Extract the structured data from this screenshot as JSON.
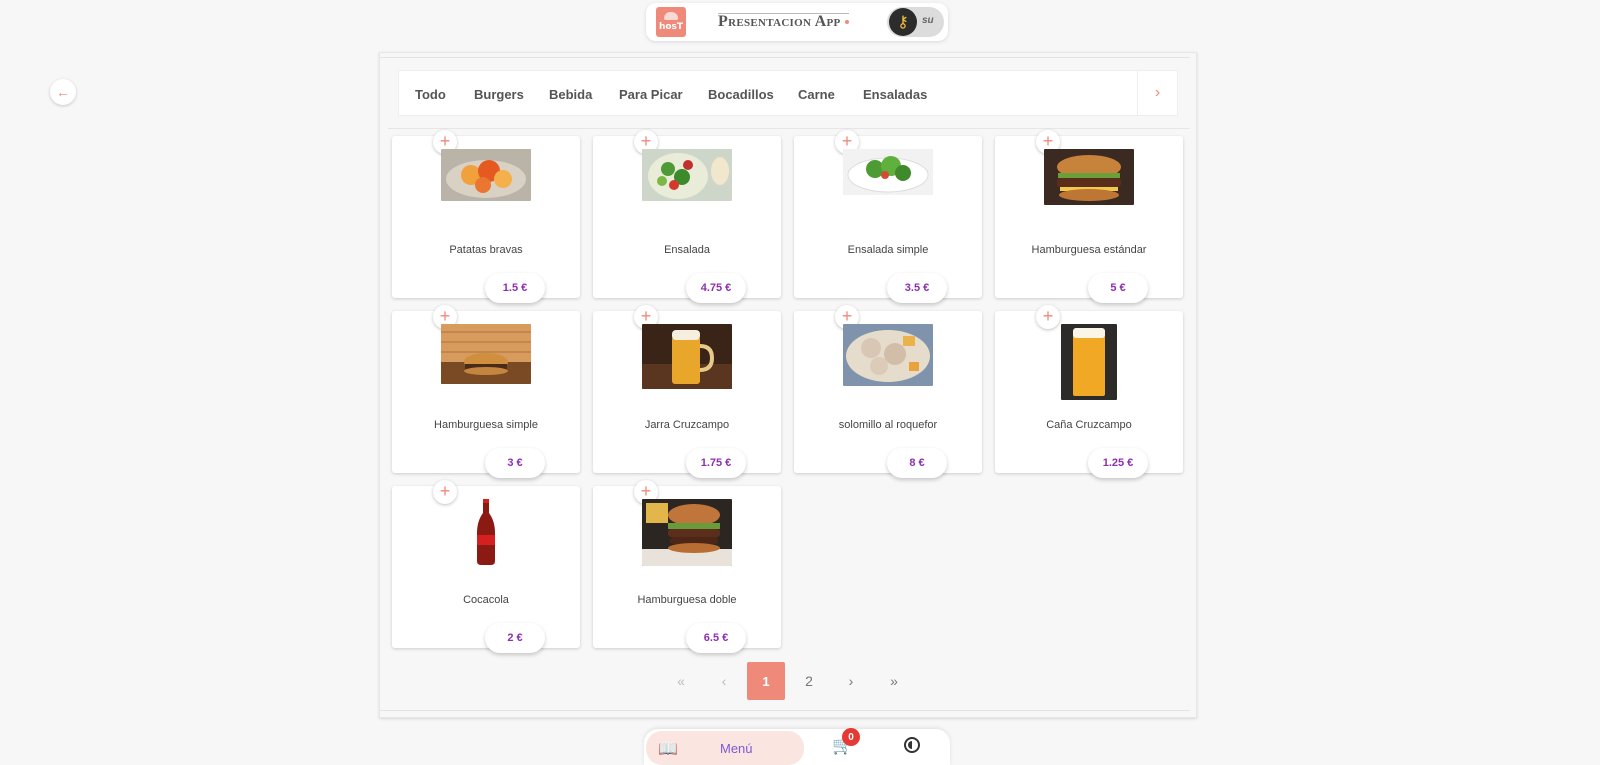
{
  "header": {
    "logo_text": "hosT",
    "app_title": "Presentacion App",
    "user_initials": "su"
  },
  "icons": {
    "back": "arrow-left-icon",
    "tabs_next": "chevron-right-icon",
    "add": "plus-icon",
    "menu": "book-icon",
    "cart": "cart-icon",
    "theme": "contrast-icon",
    "user": "key-icon"
  },
  "tabs": [
    "Todo",
    "Burgers",
    "Bebida",
    "Para Picar",
    "Bocadillos",
    "Carne",
    "Ensaladas"
  ],
  "products": [
    {
      "name": "Patatas bravas",
      "price": "1.5 €"
    },
    {
      "name": "Ensalada",
      "price": "4.75 €"
    },
    {
      "name": "Ensalada simple",
      "price": "3.5 €"
    },
    {
      "name": "Hamburguesa estándar",
      "price": "5 €"
    },
    {
      "name": "Hamburguesa simple",
      "price": "3 €"
    },
    {
      "name": "Jarra Cruzcampo",
      "price": "1.75 €"
    },
    {
      "name": "solomillo al roquefor",
      "price": "8 €"
    },
    {
      "name": "Caña Cruzcampo",
      "price": "1.25 €"
    },
    {
      "name": "Cocacola",
      "price": "2 €"
    },
    {
      "name": "Hamburguesa doble",
      "price": "6.5 €"
    }
  ],
  "pagination": {
    "first": "«",
    "prev": "‹",
    "pages": [
      "1",
      "2"
    ],
    "current": "1",
    "next": "›",
    "last": "»"
  },
  "bottom_nav": {
    "menu_label": "Menú",
    "cart_count": "0"
  },
  "colors": {
    "accent": "#ef8a7a",
    "price": "#8e2fb0",
    "menu": "#7b5bd6",
    "badge": "#e53935"
  }
}
